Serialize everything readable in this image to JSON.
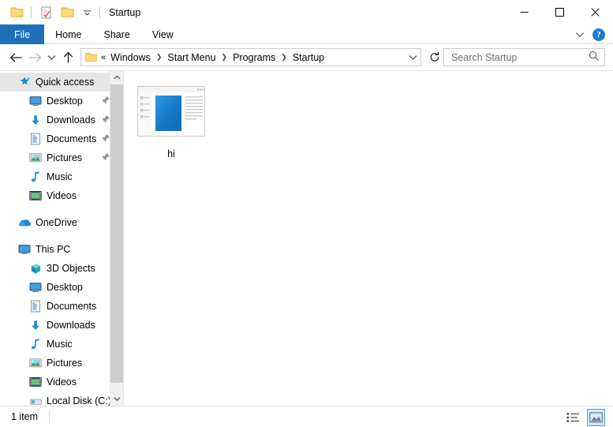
{
  "window": {
    "title": "Startup",
    "quick_access_toolbar": [
      {
        "name": "folder-icon",
        "label": "Properties folder"
      },
      {
        "name": "checkmark-document-icon",
        "label": "Properties"
      },
      {
        "name": "folder-icon",
        "label": "New folder"
      },
      {
        "name": "chevron-down-icon",
        "label": "Customize Quick Access Toolbar"
      }
    ],
    "controls": {
      "minimize": "–",
      "maximize": "□",
      "close": "✕"
    }
  },
  "ribbon": {
    "tabs": [
      {
        "label": "File",
        "active": true
      },
      {
        "label": "Home",
        "active": false
      },
      {
        "label": "Share",
        "active": false
      },
      {
        "label": "View",
        "active": false
      }
    ],
    "expand_label": "ˇ",
    "help_label": "?",
    "accent_color": "#1e6fb8"
  },
  "address_bar": {
    "back_label": "←",
    "forward_label": "→",
    "recent_label": "ˇ",
    "up_label": "↑",
    "double_chevron": "«",
    "breadcrumbs": [
      {
        "label": "Windows"
      },
      {
        "label": "Start Menu"
      },
      {
        "label": "Programs"
      },
      {
        "label": "Startup"
      }
    ],
    "separator": "❯",
    "dropdown_label": "ˇ",
    "refresh_label": "↻"
  },
  "search": {
    "placeholder": "Search Startup",
    "value": "",
    "icon": "search-icon"
  },
  "navigation_pane": {
    "groups": [
      {
        "header": {
          "label": "Quick access",
          "icon": "pinned-star-icon",
          "selected": true
        },
        "items": [
          {
            "label": "Desktop",
            "icon": "monitor-icon",
            "pinned": true
          },
          {
            "label": "Downloads",
            "icon": "download-arrow-icon",
            "pinned": true
          },
          {
            "label": "Documents",
            "icon": "document-icon",
            "pinned": true
          },
          {
            "label": "Pictures",
            "icon": "picture-icon",
            "pinned": true
          },
          {
            "label": "Music",
            "icon": "music-note-icon",
            "pinned": false
          },
          {
            "label": "Videos",
            "icon": "video-film-icon",
            "pinned": false
          }
        ]
      },
      {
        "header": {
          "label": "OneDrive",
          "icon": "onedrive-cloud-icon",
          "selected": false
        },
        "items": []
      },
      {
        "header": {
          "label": "This PC",
          "icon": "monitor-icon",
          "selected": false
        },
        "items": [
          {
            "label": "3D Objects",
            "icon": "cube-3d-icon",
            "pinned": false
          },
          {
            "label": "Desktop",
            "icon": "monitor-icon",
            "pinned": false
          },
          {
            "label": "Documents",
            "icon": "document-icon",
            "pinned": false
          },
          {
            "label": "Downloads",
            "icon": "download-arrow-icon",
            "pinned": false
          },
          {
            "label": "Music",
            "icon": "music-note-icon",
            "pinned": false
          },
          {
            "label": "Pictures",
            "icon": "picture-icon",
            "pinned": false
          },
          {
            "label": "Videos",
            "icon": "video-film-icon",
            "pinned": false
          },
          {
            "label": "Local Disk (C:)",
            "icon": "disk-drive-icon",
            "pinned": false
          }
        ]
      }
    ],
    "scrollbar": {
      "up_arrow": "˄",
      "down_arrow": "˅"
    }
  },
  "file_list": {
    "items": [
      {
        "name": "hi",
        "icon": "app-preview-icon"
      }
    ]
  },
  "status_bar": {
    "item_count": "1 item",
    "view_buttons": [
      {
        "name": "details-view-button",
        "active": false
      },
      {
        "name": "large-icons-view-button",
        "active": true
      }
    ]
  }
}
